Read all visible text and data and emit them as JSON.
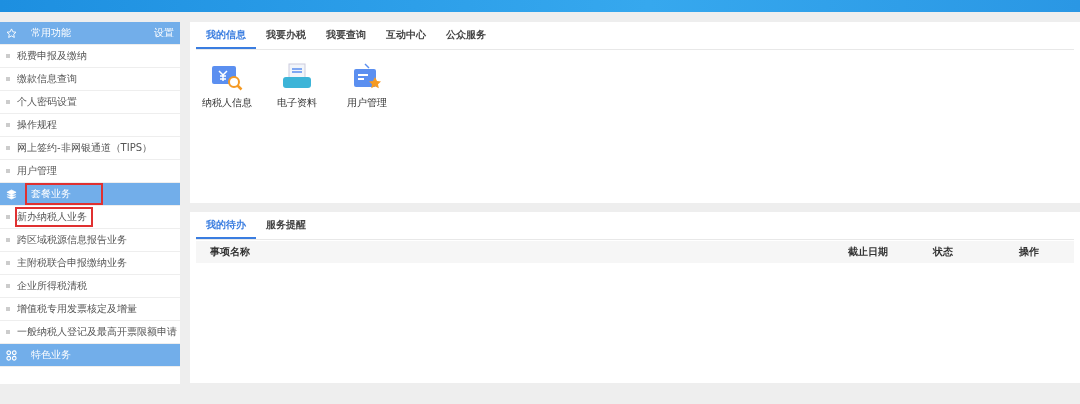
{
  "sidebar": {
    "sections": [
      {
        "kind": "star",
        "title": "常用功能",
        "action": "设置",
        "highlighted": false,
        "items": [
          {
            "label": "税费申报及缴纳",
            "highlighted": false
          },
          {
            "label": "缴款信息查询",
            "highlighted": false
          },
          {
            "label": "个人密码设置",
            "highlighted": false
          },
          {
            "label": "操作规程",
            "highlighted": false
          },
          {
            "label": "网上签约-非网银通道（TIPS）",
            "highlighted": false
          },
          {
            "label": "用户管理",
            "highlighted": false
          }
        ]
      },
      {
        "kind": "layers",
        "title": "套餐业务",
        "highlighted": true,
        "items": [
          {
            "label": "新办纳税人业务",
            "highlighted": true
          },
          {
            "label": "跨区域税源信息报告业务",
            "highlighted": false
          },
          {
            "label": "主附税联合申报缴纳业务",
            "highlighted": false
          },
          {
            "label": "企业所得税清税",
            "highlighted": false
          },
          {
            "label": "增值税专用发票核定及增量",
            "highlighted": false
          },
          {
            "label": "一般纳税人登记及最高开票限额申请",
            "highlighted": false
          }
        ]
      },
      {
        "kind": "grid",
        "title": "特色业务",
        "highlighted": false
      }
    ]
  },
  "info_panel": {
    "tabs": [
      {
        "label": "我的信息",
        "selected": true
      },
      {
        "label": "我要办税",
        "selected": false
      },
      {
        "label": "我要查询",
        "selected": false
      },
      {
        "label": "互动中心",
        "selected": false
      },
      {
        "label": "公众服务",
        "selected": false
      }
    ],
    "shortcuts": [
      {
        "kind": "taxpayer",
        "label": "纳税人信息"
      },
      {
        "kind": "document",
        "label": "电子资料"
      },
      {
        "kind": "user",
        "label": "用户管理"
      }
    ]
  },
  "todo_panel": {
    "tabs": [
      {
        "label": "我的待办",
        "selected": true
      },
      {
        "label": "服务提醒",
        "selected": false
      }
    ],
    "table": {
      "columns": [
        "事项名称",
        "截止日期",
        "状态",
        "操作"
      ]
    }
  }
}
